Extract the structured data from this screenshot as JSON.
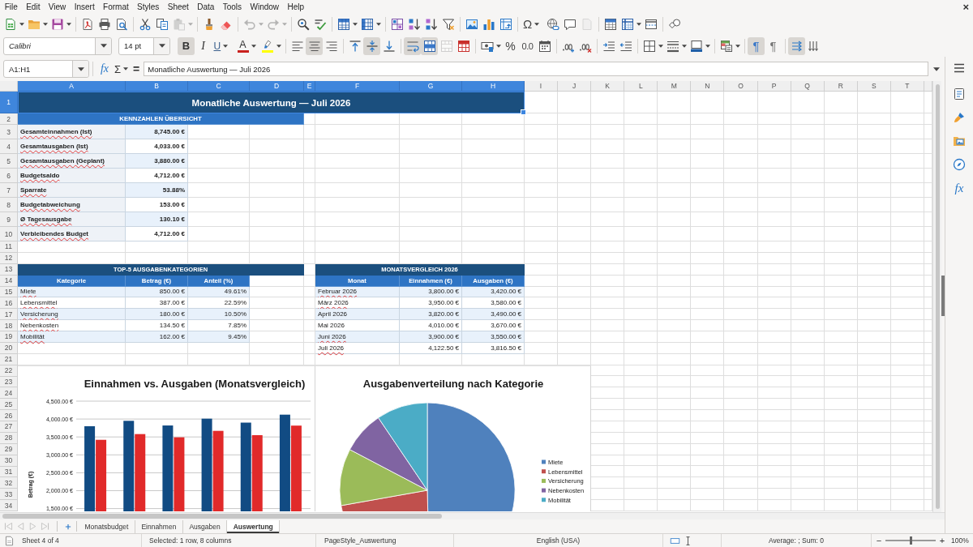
{
  "menu_bar": {
    "items": [
      "File",
      "Edit",
      "View",
      "Insert",
      "Format",
      "Styles",
      "Sheet",
      "Data",
      "Tools",
      "Window",
      "Help"
    ],
    "close": "×"
  },
  "standard_toolbar": [
    {
      "disabled": false
    },
    {
      "disabled": false
    },
    {
      "disabled": false
    },
    {
      "disabled": false
    },
    {
      "disabled": false
    },
    {
      "disabled": false
    },
    {
      "disabled": false
    },
    {
      "disabled": false
    },
    {
      "disabled": true
    },
    {
      "disabled": false
    },
    {
      "disabled": false
    },
    {
      "disabled": true
    },
    {
      "disabled": true
    },
    {
      "disabled": false
    },
    {
      "disabled": false
    },
    {
      "disabled": false
    },
    {
      "disabled": false
    },
    {
      "disabled": false
    },
    {
      "disabled": false
    },
    {
      "disabled": false
    },
    {
      "disabled": false
    },
    {
      "disabled": false
    },
    {
      "disabled": false
    },
    {
      "disabled": false
    },
    {
      "label": "Ω",
      "disabled": false
    },
    {
      "disabled": false
    },
    {
      "disabled": false
    },
    {
      "disabled": true
    },
    {
      "disabled": false
    },
    {
      "disabled": false
    },
    {
      "disabled": false
    },
    {
      "disabled": false
    }
  ],
  "formatting_toolbar": {
    "font_name": "Calibri",
    "font_size": "14 pt",
    "buttons": [
      {
        "label": "B",
        "pressed": true,
        "disabled": false
      },
      {
        "label": "I",
        "pressed": false,
        "disabled": false
      },
      {
        "label": "U",
        "pressed": false,
        "disabled": false
      },
      {
        "label": "A",
        "color": "#c9211e",
        "pressed": false,
        "disabled": false
      },
      {
        "color": "#ffff00",
        "pressed": false,
        "disabled": false
      },
      {
        "pressed": false,
        "disabled": false
      },
      {
        "pressed": true,
        "disabled": false
      },
      {
        "pressed": false,
        "disabled": false
      },
      {
        "pressed": false,
        "disabled": false
      },
      {
        "pressed": true,
        "disabled": false
      },
      {
        "pressed": false,
        "disabled": false
      },
      {
        "pressed": true,
        "disabled": false
      },
      {
        "pressed": true,
        "disabled": false
      },
      {
        "pressed": false,
        "disabled": true
      },
      {
        "pressed": false,
        "disabled": false
      },
      {
        "pressed": false,
        "disabled": false
      },
      {
        "label": "%",
        "pressed": false,
        "disabled": false
      },
      {
        "label": "0.0",
        "pressed": false,
        "disabled": false
      },
      {
        "pressed": false,
        "disabled": false
      },
      {
        "pressed": false,
        "disabled": false
      },
      {
        "pressed": false,
        "disabled": false
      },
      {
        "pressed": false,
        "disabled": false
      },
      {
        "pressed": false,
        "disabled": false
      },
      {
        "pressed": false,
        "disabled": false
      },
      {
        "pressed": false,
        "disabled": false
      },
      {
        "pressed": false,
        "disabled": false
      },
      {
        "pressed": false,
        "disabled": false
      },
      {
        "label": "¶",
        "pressed": true,
        "disabled": false
      },
      {
        "label": "¶",
        "pressed": false,
        "disabled": false
      },
      {
        "pressed": true,
        "disabled": false
      },
      {
        "pressed": false,
        "disabled": false
      }
    ]
  },
  "formula_bar": {
    "name_box": "A1:H1",
    "function_wizard": "fx",
    "sum": "Σ",
    "equals": "=",
    "content": "Monatliche Auswertung — Juli 2026"
  },
  "sheet": {
    "columns": [
      {
        "label": "A",
        "selected": true
      },
      {
        "label": "B",
        "selected": true
      },
      {
        "label": "C",
        "selected": true
      },
      {
        "label": "D",
        "selected": true
      },
      {
        "label": "E",
        "selected": true
      },
      {
        "label": "F",
        "selected": true
      },
      {
        "label": "G",
        "selected": true
      },
      {
        "label": "H",
        "selected": true
      },
      {
        "label": "I",
        "selected": false
      },
      {
        "label": "J",
        "selected": false
      },
      {
        "label": "K",
        "selected": false
      },
      {
        "label": "L",
        "selected": false
      },
      {
        "label": "M",
        "selected": false
      },
      {
        "label": "N",
        "selected": false
      },
      {
        "label": "O",
        "selected": false
      },
      {
        "label": "P",
        "selected": false
      },
      {
        "label": "Q",
        "selected": false
      },
      {
        "label": "R",
        "selected": false
      },
      {
        "label": "S",
        "selected": false
      },
      {
        "label": "T",
        "selected": false
      }
    ],
    "rows": [
      {
        "label": "1",
        "selected": true
      },
      {
        "label": "2",
        "selected": false
      },
      {
        "label": "3",
        "selected": false
      },
      {
        "label": "4",
        "selected": false
      },
      {
        "label": "5",
        "selected": false
      },
      {
        "label": "6",
        "selected": false
      },
      {
        "label": "7",
        "selected": false
      },
      {
        "label": "8",
        "selected": false
      },
      {
        "label": "9",
        "selected": false
      },
      {
        "label": "10",
        "selected": false
      },
      {
        "label": "11",
        "selected": false
      },
      {
        "label": "12",
        "selected": false
      },
      {
        "label": "13",
        "selected": false
      },
      {
        "label": "14",
        "selected": false
      },
      {
        "label": "15",
        "selected": false
      },
      {
        "label": "16",
        "selected": false
      },
      {
        "label": "17",
        "selected": false
      },
      {
        "label": "18",
        "selected": false
      },
      {
        "label": "19",
        "selected": false
      },
      {
        "label": "20",
        "selected": false
      },
      {
        "label": "21",
        "selected": false
      },
      {
        "label": "22",
        "selected": false
      },
      {
        "label": "23",
        "selected": false
      },
      {
        "label": "24",
        "selected": false
      },
      {
        "label": "25",
        "selected": false
      },
      {
        "label": "26",
        "selected": false
      },
      {
        "label": "27",
        "selected": false
      },
      {
        "label": "28",
        "selected": false
      },
      {
        "label": "29",
        "selected": false
      },
      {
        "label": "30",
        "selected": false
      },
      {
        "label": "31",
        "selected": false
      },
      {
        "label": "32",
        "selected": false
      },
      {
        "label": "33",
        "selected": false
      },
      {
        "label": "34",
        "selected": false
      }
    ],
    "title": {
      "text": "Monatliche Auswertung — Juli 2026",
      "selected": true
    },
    "kpi": {
      "header": "KENNZAHLEN ÜBERSICHT",
      "rows": [
        {
          "label": "Gesamteinnahmen (Ist)",
          "value": "8,745.00 €",
          "spelling_error": true
        },
        {
          "label": "Gesamtausgaben (Ist)",
          "value": "4,033.00 €",
          "spelling_error": true
        },
        {
          "label": "Gesamtausgaben (Geplant)",
          "value": "3,880.00 €",
          "spelling_error": true
        },
        {
          "label": "Budgetsaldo",
          "value": "4,712.00 €",
          "spelling_error": true
        },
        {
          "label": "Sparrate",
          "value": "53.88%",
          "spelling_error": true
        },
        {
          "label": "Budgetabweichung",
          "value": "153.00 €",
          "spelling_error": true
        },
        {
          "label": "Ø Tagesausgabe",
          "value": "130.10 €",
          "spelling_error": true
        },
        {
          "label": "Verbleibendes Budget",
          "value": "4,712.00 €",
          "spelling_error": true
        }
      ]
    },
    "top_categories": {
      "header": "TOP-5 AUSGABENKATEGORIEN",
      "columns": [
        "Kategorie",
        "Betrag (€)",
        "Anteil (%)"
      ],
      "rows": [
        {
          "category": "Miete",
          "amount": "850.00 €",
          "share": "49.61%",
          "spelling_error": true
        },
        {
          "category": "Lebensmittel",
          "amount": "387.00 €",
          "share": "22.59%",
          "spelling_error": true
        },
        {
          "category": "Versicherung",
          "amount": "180.00 €",
          "share": "10.50%",
          "spelling_error": true
        },
        {
          "category": "Nebenkosten",
          "amount": "134.50 €",
          "share": "7.85%",
          "spelling_error": true
        },
        {
          "category": "Mobilität",
          "amount": "162.00 €",
          "share": "9.45%",
          "spelling_error": true
        }
      ]
    },
    "monthly_comparison": {
      "header": "MONATSVERGLEICH 2026",
      "columns": [
        "Monat",
        "Einnahmen (€)",
        "Ausgaben (€)"
      ],
      "rows": [
        {
          "month": "Februar 2026",
          "income": "3,800.00 €",
          "expenses": "3,420.00 €",
          "spelling_error": true
        },
        {
          "month": "März 2026",
          "income": "3,950.00 €",
          "expenses": "3,580.00 €",
          "spelling_error": true
        },
        {
          "month": "April 2026",
          "income": "3,820.00 €",
          "expenses": "3,490.00 €",
          "spelling_error": false
        },
        {
          "month": "Mai 2026",
          "income": "4,010.00 €",
          "expenses": "3,670.00 €",
          "spelling_error": false
        },
        {
          "month": "Juni 2026",
          "income": "3,900.00 €",
          "expenses": "3,550.00 €",
          "spelling_error": true
        },
        {
          "month": "Juli 2026",
          "income": "4,122.50 €",
          "expenses": "3,816.50 €",
          "spelling_error": true
        }
      ]
    },
    "bar_chart": {
      "chart_data": {
        "type": "bar",
        "title": "Einnahmen vs. Ausgaben (Monatsvergleich)",
        "ylabel": "Betrag (€)",
        "series": [
          {
            "color": "#114b83",
            "values": [
              3800,
              3950,
              3820,
              4010,
              3900,
              4122.5
            ]
          },
          {
            "color": "#e12a2a",
            "values": [
              3420,
              3580,
              3490,
              3670,
              3550,
              3816.5
            ]
          }
        ],
        "ylim": [
          1400,
          4500
        ],
        "yticks": [
          {
            "value": 1500,
            "label": "1,500.00 €"
          },
          {
            "value": 2000,
            "label": "2,000.00 €"
          },
          {
            "value": 2500,
            "label": "2,500.00 €"
          },
          {
            "value": 3000,
            "label": "3,000.00 €"
          },
          {
            "value": 3500,
            "label": "3,500.00 €"
          },
          {
            "value": 4000,
            "label": "4,000.00 €"
          },
          {
            "value": 4500,
            "label": "4,500.00 €"
          }
        ],
        "grid": true
      }
    },
    "pie_chart": {
      "chart_data": {
        "type": "pie",
        "title": "Ausgabenverteilung nach Kategorie",
        "categories": [
          "Miete",
          "Lebensmittel",
          "Versicherung",
          "Nebenkosten",
          "Mobilität"
        ],
        "values": [
          49.61,
          22.59,
          10.5,
          7.85,
          9.45
        ],
        "colors": [
          "#4f81bd",
          "#c0504d",
          "#9bbb59",
          "#8064a2",
          "#4bacc6"
        ],
        "legend": "right"
      }
    }
  },
  "sheet_navigation": [
    {
      "disabled": true
    },
    {
      "disabled": true
    },
    {
      "disabled": true
    },
    {
      "disabled": true
    }
  ],
  "sheet_tabs": [
    {
      "label": "Monatsbudget",
      "selected": false
    },
    {
      "label": "Einnahmen",
      "selected": false
    },
    {
      "label": "Ausgaben",
      "selected": false
    },
    {
      "label": "Auswertung",
      "selected": true
    }
  ],
  "sidebar": {
    "functions": "fx"
  },
  "status_bar": {
    "sheet": "Sheet 4 of 4",
    "selection": "Selected: 1 row, 8 columns",
    "page_style": "PageStyle_Auswertung",
    "language": "English (USA)",
    "statistics": "Average: ; Sum: 0",
    "zoom_out": "−",
    "zoom_slider": {
      "level": 0.5
    },
    "zoom_in": "+",
    "zoom_percent": "100%"
  }
}
